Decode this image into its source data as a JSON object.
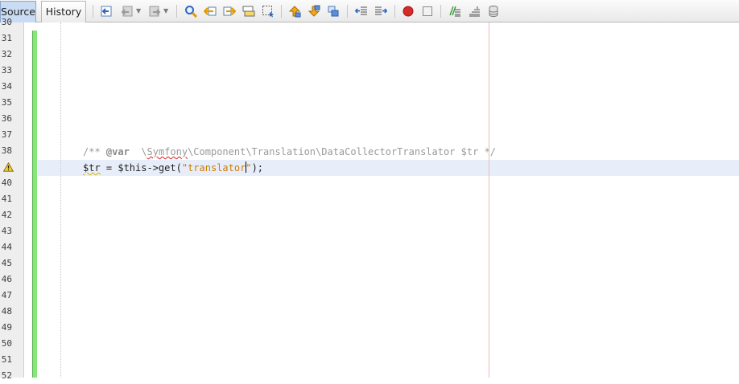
{
  "tabs": {
    "source": "Source",
    "history": "History"
  },
  "toolbar_icons": [
    "last-edit-icon",
    "back-icon",
    "forward-icon",
    "find-selection-icon",
    "find-previous-icon",
    "find-next-icon",
    "toggle-highlight-icon",
    "toggle-rectangular-selection-icon",
    "previous-bookmark-icon",
    "next-bookmark-icon",
    "toggle-bookmark-icon",
    "shift-left-icon",
    "shift-right-icon",
    "start-macro-recording-icon",
    "stop-macro-recording-icon",
    "comment-icon",
    "uncomment-icon",
    "database-icon"
  ],
  "line_numbers": [
    "30",
    "31",
    "32",
    "33",
    "34",
    "35",
    "36",
    "37",
    "38",
    "39",
    "40",
    "41",
    "42",
    "43",
    "44",
    "45",
    "46",
    "47",
    "48",
    "49",
    "50",
    "51",
    "52"
  ],
  "warning_line": "39",
  "code": {
    "line38": {
      "open": "/** ",
      "tag": "@var",
      "space": "  \\",
      "misspelled": "Symfony",
      "rest": "\\Component\\Translation\\DataCollectorTranslator $tr */"
    },
    "line39": {
      "var": "$tr",
      "mid": " = $this->get(",
      "str_open": "\"translator",
      "str_close": "\"",
      "end": ");"
    }
  },
  "colors": {
    "change_bar": "#87e67a",
    "current_line": "#e8eef9",
    "string": "#ce7b00",
    "comment": "#9a9a9a",
    "margin": "#f2b8b8"
  }
}
